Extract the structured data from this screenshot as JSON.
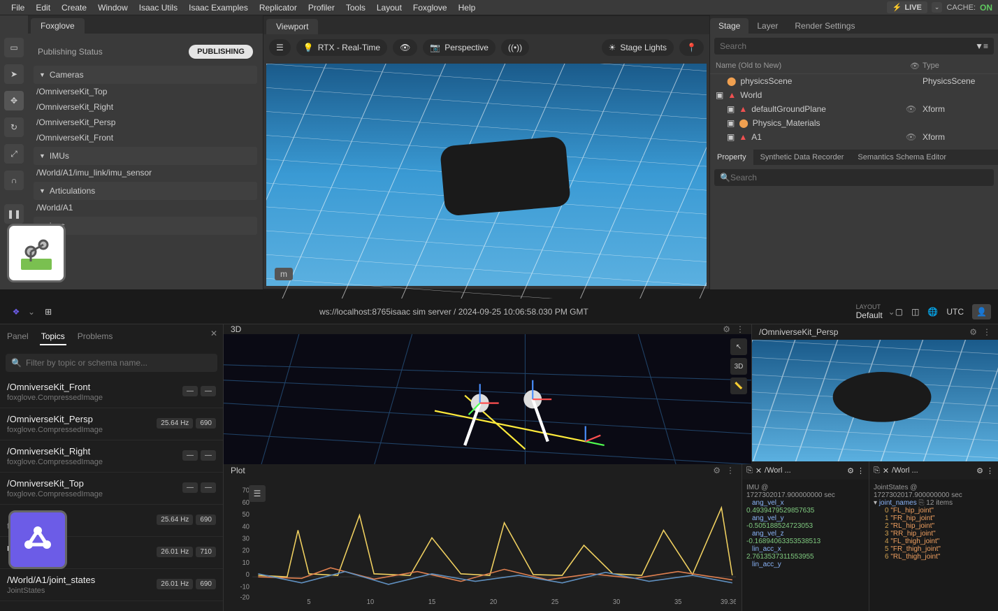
{
  "menubar": {
    "items": [
      "File",
      "Edit",
      "Create",
      "Window",
      "Isaac Utils",
      "Isaac Examples",
      "Replicator",
      "Profiler",
      "Tools",
      "Layout",
      "Foxglove",
      "Help"
    ],
    "live": "LIVE",
    "cache_label": "CACHE:",
    "cache_state": "ON"
  },
  "foxglove_panel": {
    "tab": "Foxglove",
    "status_label": "Publishing Status",
    "status_value": "PUBLISHING",
    "sections": {
      "cameras": {
        "title": "Cameras",
        "items": [
          "/OmniverseKit_Top",
          "/OmniverseKit_Right",
          "/OmniverseKit_Persp",
          "/OmniverseKit_Front"
        ]
      },
      "imus": {
        "title": "IMUs",
        "items": [
          "/World/A1/imu_link/imu_sensor"
        ]
      },
      "articulations": {
        "title": "Articulations",
        "items": [
          "/World/A1"
        ]
      },
      "settings": {
        "title_partial": "ings"
      }
    }
  },
  "viewport": {
    "tab": "Viewport",
    "render_mode": "RTX - Real-Time",
    "camera_mode": "Perspective",
    "lights": "Stage Lights",
    "unit_badge": "m"
  },
  "stage": {
    "tabs": [
      "Stage",
      "Layer",
      "Render Settings"
    ],
    "search_placeholder": "Search",
    "col_name": "Name (Old to New)",
    "col_type": "Type",
    "rows": [
      {
        "name": "physicsScene",
        "type": "PhysicsScene",
        "indent": 1,
        "icon": "physics"
      },
      {
        "name": "World",
        "type": "",
        "indent": 0,
        "icon": "axis"
      },
      {
        "name": "defaultGroundPlane",
        "type": "Xform",
        "indent": 1,
        "icon": "axis",
        "eye": true
      },
      {
        "name": "Physics_Materials",
        "type": "",
        "indent": 1,
        "icon": "physics"
      },
      {
        "name": "A1",
        "type": "Xform",
        "indent": 1,
        "icon": "axis",
        "eye": true
      }
    ],
    "prop_tabs": [
      "Property",
      "Synthetic Data Recorder",
      "Semantics Schema Editor"
    ],
    "prop_search_placeholder": "Search"
  },
  "fg_header": {
    "connection": "ws://localhost:8765isaac sim server / 2024-09-25 10:06:58.030 PM GMT",
    "layout_label": "LAYOUT",
    "layout_value": "Default",
    "tz": "UTC"
  },
  "fg_left": {
    "tabs": [
      "Panel",
      "Topics",
      "Problems"
    ],
    "search_placeholder": "Filter by topic or schema name...",
    "topics": [
      {
        "name": "/OmniverseKit_Front",
        "type": "foxglove.CompressedImage",
        "hz": "—",
        "count": "—"
      },
      {
        "name": "/OmniverseKit_Persp",
        "type": "foxglove.CompressedImage",
        "hz": "25.64 Hz",
        "count": "690"
      },
      {
        "name": "/OmniverseKit_Right",
        "type": "foxglove.CompressedImage",
        "hz": "—",
        "count": "—"
      },
      {
        "name": "/OmniverseKit_Top",
        "type": "foxglove.CompressedImage",
        "hz": "—",
        "count": "—"
      },
      {
        "name": "",
        "type_partial": "forms",
        "hz": "25.64 Hz",
        "count": "690"
      },
      {
        "name_partial": "nk/imu_sensor",
        "type": "",
        "hz": "26.01 Hz",
        "count": "710"
      },
      {
        "name": "/World/A1/joint_states",
        "type": "JointStates",
        "hz": "26.01 Hz",
        "count": "690"
      }
    ]
  },
  "fg_3d": {
    "title": "3D"
  },
  "fg_image": {
    "title": "/OmniverseKit_Persp"
  },
  "fg_plot": {
    "title": "Plot"
  },
  "chart_data": {
    "type": "line",
    "xlim": [
      0,
      39.36
    ],
    "ylim": [
      -20,
      70
    ],
    "yticks": [
      -20,
      -10,
      0,
      10,
      20,
      30,
      40,
      50,
      60,
      70
    ],
    "xticks": [
      5,
      10,
      15,
      20,
      25,
      30,
      35,
      39.36
    ],
    "series": [
      {
        "name": "ang_vel_x",
        "color": "#f0d060"
      },
      {
        "name": "ang_vel_y",
        "color": "#e08050"
      },
      {
        "name": "ang_vel_z",
        "color": "#6090c0"
      }
    ]
  },
  "raw_imu": {
    "header_path": "/Worl ...",
    "title": "IMU @",
    "timestamp": "1727302017.900000000 sec",
    "items": [
      {
        "key": "ang_vel_x",
        "val": "0.4939479529857635"
      },
      {
        "key": "ang_vel_y",
        "val": "-0.505188524723053"
      },
      {
        "key": "ang_vel_z",
        "val": "-0.16894063353538513"
      },
      {
        "key": "lin_acc_x",
        "val": "2.7613537311553955"
      },
      {
        "key": "lin_acc_y",
        "val": ""
      }
    ]
  },
  "raw_joints": {
    "header_path": "/Worl ...",
    "title": "JointStates @",
    "timestamp": "1727302017.900000000 sec",
    "array_key": "joint_names",
    "array_count": "12 items",
    "items": [
      {
        "idx": "0",
        "val": "\"FL_hip_joint\""
      },
      {
        "idx": "1",
        "val": "\"FR_hip_joint\""
      },
      {
        "idx": "2",
        "val": "\"RL_hip_joint\""
      },
      {
        "idx": "3",
        "val": "\"RR_hip_joint\""
      },
      {
        "idx": "4",
        "val": "\"FL_thigh_joint\""
      },
      {
        "idx": "5",
        "val": "\"FR_thigh_joint\""
      },
      {
        "idx": "6",
        "val": "\"RL_thigh_joint\""
      }
    ]
  }
}
